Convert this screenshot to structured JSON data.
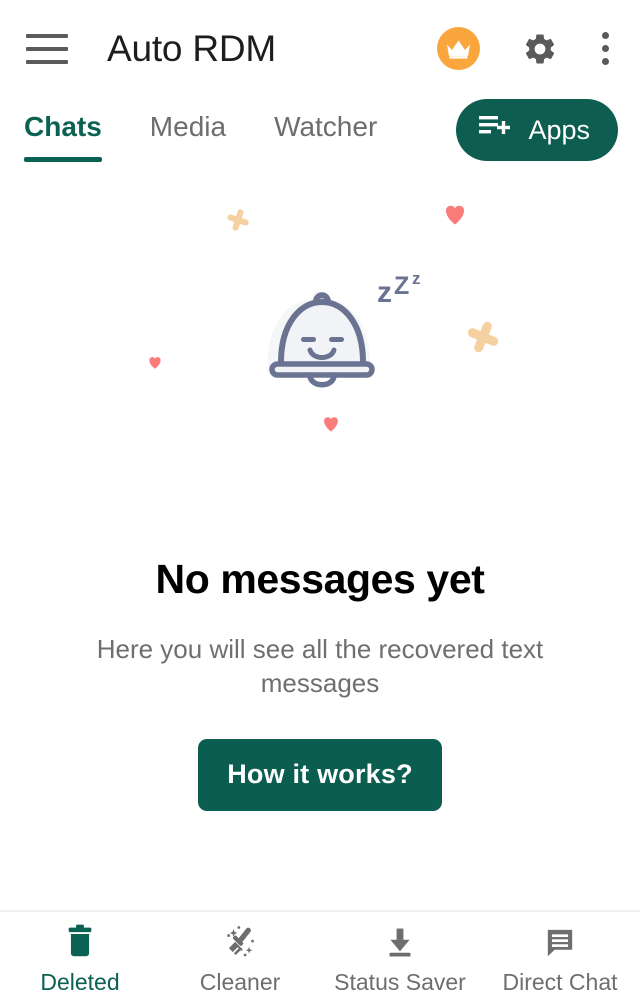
{
  "theme": {
    "primary_green": "#0b6152",
    "button_green": "#0b5d4f",
    "apps_green": "#0d5e50",
    "crown_orange": "#FBA63C",
    "heart_pink": "#FB7A7A",
    "sparkle_tan": "#F5D0A0",
    "bell_outline": "#6b7392",
    "bell_fill": "#eceef2",
    "muted_gray": "#6e6e6e",
    "icon_gray": "#5a5a5a"
  },
  "header": {
    "title": "Auto RDM",
    "menu_icon": "hamburger-menu-icon",
    "crown_icon": "crown-icon",
    "settings_icon": "gear-icon",
    "overflow_icon": "more-vertical-icon"
  },
  "tabs": {
    "items": [
      {
        "label": "Chats",
        "active": true
      },
      {
        "label": "Media",
        "active": false
      },
      {
        "label": "Watcher",
        "active": false
      }
    ],
    "apps_button": {
      "label": "Apps",
      "icon": "playlist-add-icon"
    }
  },
  "empty_state": {
    "illustration": "sleeping-bell-illustration",
    "sleep_text": "zZ",
    "sleep_text_small": "z",
    "title": "No messages yet",
    "subtitle": "Here you will see all the recovered text messages",
    "cta_label": "How it works?"
  },
  "bottom_nav": {
    "items": [
      {
        "label": "Deleted",
        "icon": "trash-icon",
        "active": true
      },
      {
        "label": "Cleaner",
        "icon": "broom-sparkle-icon",
        "active": false
      },
      {
        "label": "Status Saver",
        "icon": "download-icon",
        "active": false
      },
      {
        "label": "Direct Chat",
        "icon": "chat-bubble-icon",
        "active": false
      }
    ]
  }
}
